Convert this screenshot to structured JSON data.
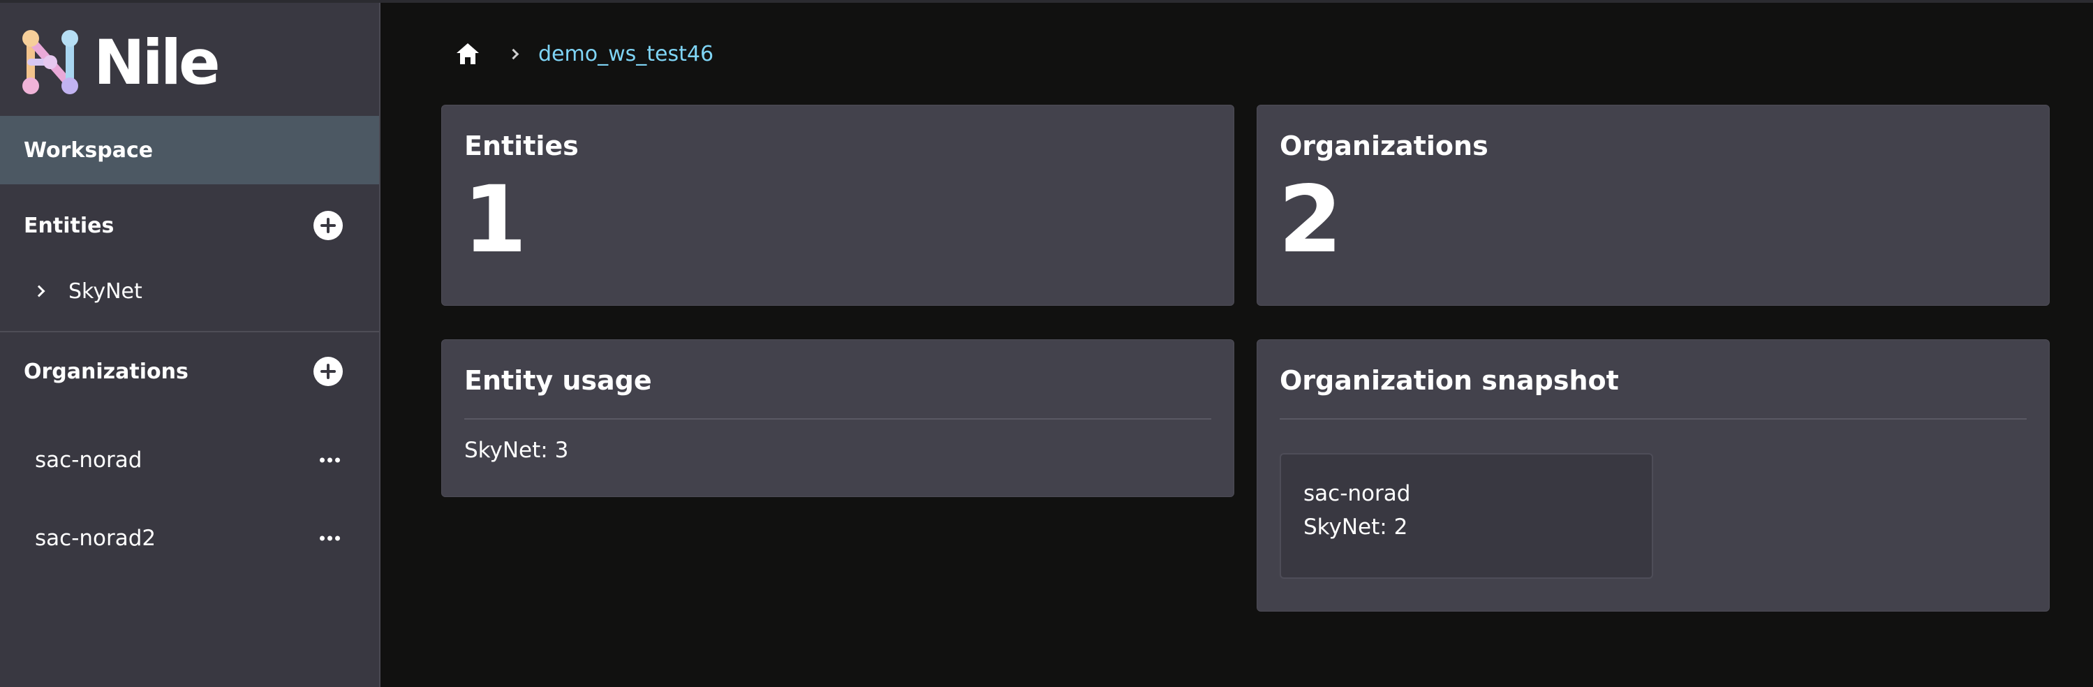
{
  "app": {
    "logo_text": "Nile"
  },
  "sidebar": {
    "workspace_label": "Workspace",
    "entities_section": {
      "label": "Entities",
      "items": [
        {
          "label": "SkyNet"
        }
      ]
    },
    "organizations_section": {
      "label": "Organizations",
      "items": [
        {
          "label": "sac-norad"
        },
        {
          "label": "sac-norad2"
        }
      ]
    }
  },
  "breadcrumb": {
    "current": "demo_ws_test46"
  },
  "cards": {
    "entities": {
      "title": "Entities",
      "count": "1"
    },
    "organizations": {
      "title": "Organizations",
      "count": "2"
    },
    "entity_usage": {
      "title": "Entity usage",
      "rows": [
        "SkyNet: 3"
      ]
    },
    "org_snapshot": {
      "title": "Organization snapshot",
      "org_name": "sac-norad",
      "usage": "SkyNet: 2"
    }
  },
  "colors": {
    "accent_link": "#7fd4f5",
    "sidebar_bg": "#393841",
    "card_bg": "#43424c",
    "page_bg": "#111110",
    "active_nav": "#4c5863"
  },
  "icons": [
    "nile-logo-icon",
    "plus-circle-icon",
    "chevron-right-icon",
    "more-horizontal-icon",
    "home-icon"
  ]
}
